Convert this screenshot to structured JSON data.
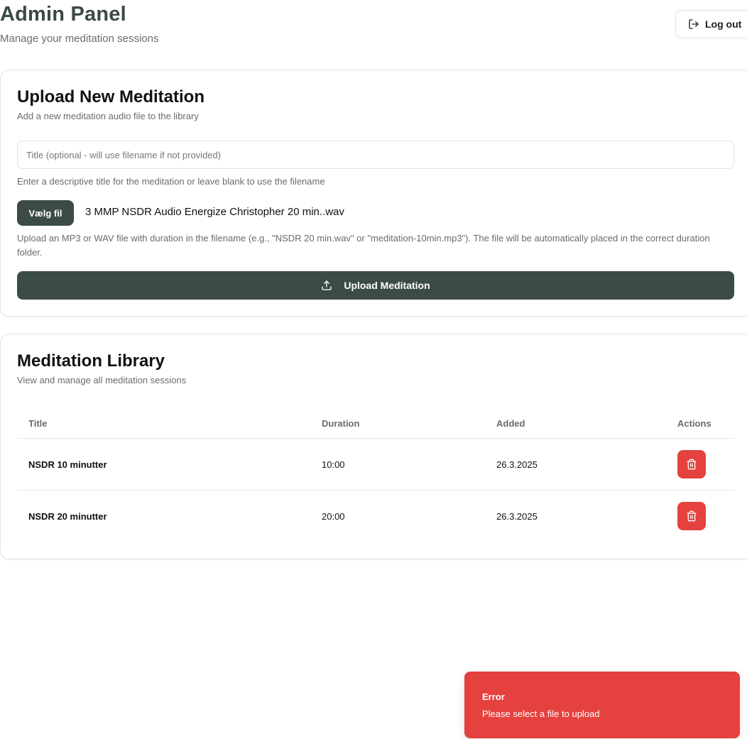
{
  "header": {
    "title": "Admin Panel",
    "subtitle": "Manage your meditation sessions",
    "logout_label": "Log out"
  },
  "upload": {
    "title": "Upload New Meditation",
    "description": "Add a new meditation audio file to the library",
    "title_input_placeholder": "Title (optional - will use filename if not provided)",
    "title_input_value": "",
    "title_helper": "Enter a descriptive title for the meditation or leave blank to use the filename",
    "file_button_label": "Vælg fil",
    "selected_file": "3 MMP NSDR Audio Energize Christopher 20 min..wav",
    "file_helper": "Upload an MP3 or WAV file with duration in the filename (e.g., \"NSDR 20 min.wav\" or \"meditation-10min.mp3\"). The file will be automatically placed in the correct duration folder.",
    "submit_label": "Upload Meditation"
  },
  "library": {
    "title": "Meditation Library",
    "description": "View and manage all meditation sessions",
    "columns": [
      "Title",
      "Duration",
      "Added",
      "Actions"
    ],
    "rows": [
      {
        "title": "NSDR 10 minutter",
        "duration": "10:00",
        "added": "26.3.2025"
      },
      {
        "title": "NSDR 20 minutter",
        "duration": "20:00",
        "added": "26.3.2025"
      }
    ]
  },
  "toast": {
    "title": "Error",
    "message": "Please select a file to upload"
  },
  "colors": {
    "primary": "#3c4c44",
    "danger": "#e5413e",
    "heading": "#3a4a42",
    "muted": "#6b6b6b"
  },
  "icons": {
    "logout": "log-out-icon",
    "upload": "upload-icon",
    "delete": "trash-icon"
  }
}
